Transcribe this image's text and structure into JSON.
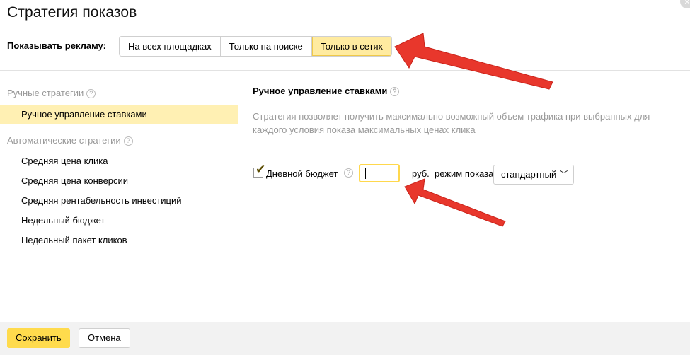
{
  "dialog": {
    "title": "Стратегия показов",
    "close_glyph": "×"
  },
  "show_ads": {
    "label": "Показывать рекламу:",
    "options": [
      "На всех площадках",
      "Только на поиске",
      "Только в сетях"
    ],
    "selected": "Только в сетях"
  },
  "sidebar": {
    "groups": [
      {
        "label": "Ручные стратегии",
        "items": [
          "Ручное управление ставками"
        ]
      },
      {
        "label": "Автоматические стратегии",
        "items": [
          "Средняя цена клика",
          "Средняя цена конверсии",
          "Средняя рентабельность инвестиций",
          "Недельный бюджет",
          "Недельный пакет кликов"
        ]
      }
    ],
    "active_item": "Ручное управление ставками"
  },
  "main": {
    "title": "Ручное управление ставками",
    "description": "Стратегия позволяет получить максимально возможный объем трафика при выбранных для каждого условия показа максимальных ценах клика",
    "daily_budget": {
      "label": "Дневной бюджет",
      "checked": true,
      "value": "",
      "currency": "руб.",
      "mode_label": "режим показа",
      "mode_value": "стандартный"
    }
  },
  "footer": {
    "save_label": "Сохранить",
    "cancel_label": "Отмена"
  },
  "icons": {
    "help": "question-circle-icon",
    "close": "close-icon",
    "chevron": "chevron-down-icon",
    "arrow_color": "#e8372c"
  },
  "colors": {
    "accent_yellow": "#ffdb4d",
    "selected_tab": "#ffeba0",
    "active_item_bg": "#fff0b3"
  }
}
